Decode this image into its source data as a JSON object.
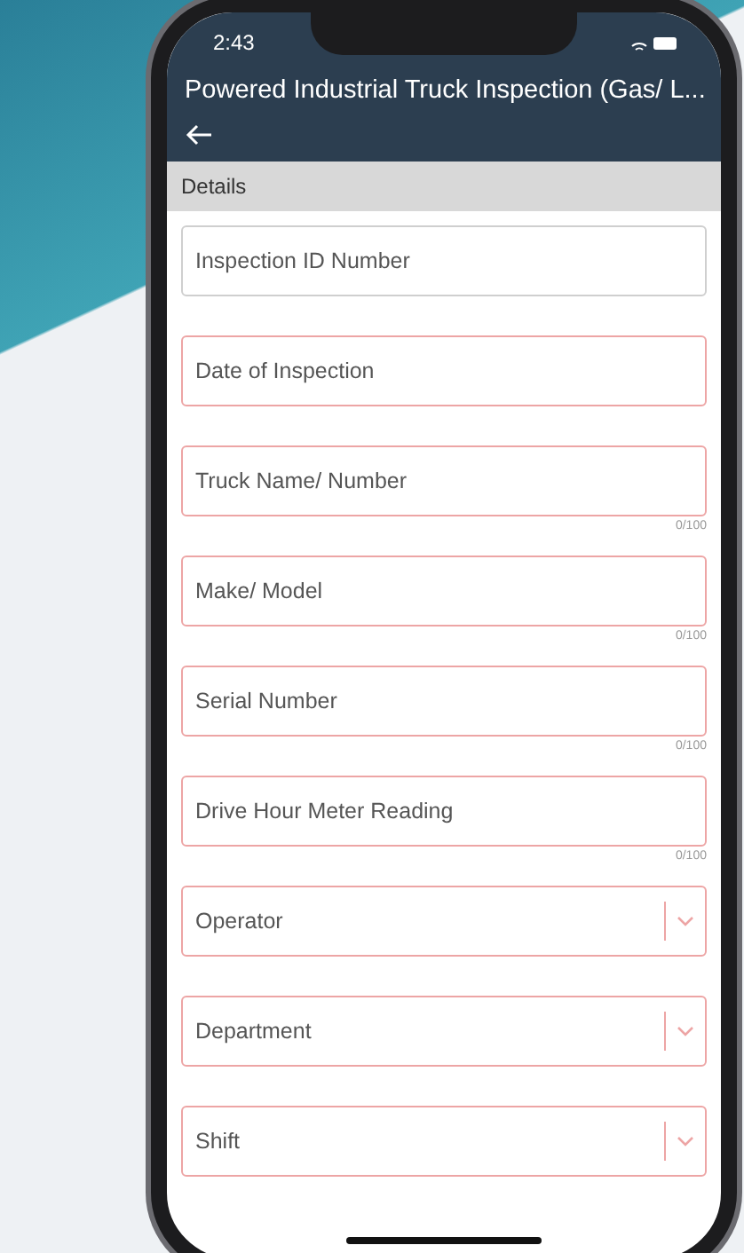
{
  "status_bar": {
    "time": "2:43"
  },
  "header": {
    "title": "Powered Industrial Truck Inspection (Gas/ L..."
  },
  "section": {
    "title": "Details"
  },
  "fields": [
    {
      "kind": "text",
      "placeholder": "Inspection ID Number",
      "required": false
    },
    {
      "kind": "text",
      "placeholder": "Date of Inspection",
      "required": true
    },
    {
      "kind": "text",
      "placeholder": "Truck Name/ Number",
      "required": true,
      "counter": "0/100"
    },
    {
      "kind": "text",
      "placeholder": "Make/ Model",
      "required": true,
      "counter": "0/100"
    },
    {
      "kind": "text",
      "placeholder": "Serial Number",
      "required": true,
      "counter": "0/100"
    },
    {
      "kind": "text",
      "placeholder": "Drive Hour Meter Reading",
      "required": true,
      "counter": "0/100"
    },
    {
      "kind": "dropdown",
      "placeholder": "Operator",
      "required": true
    },
    {
      "kind": "dropdown",
      "placeholder": "Department",
      "required": true
    },
    {
      "kind": "dropdown",
      "placeholder": "Shift",
      "required": true
    }
  ]
}
